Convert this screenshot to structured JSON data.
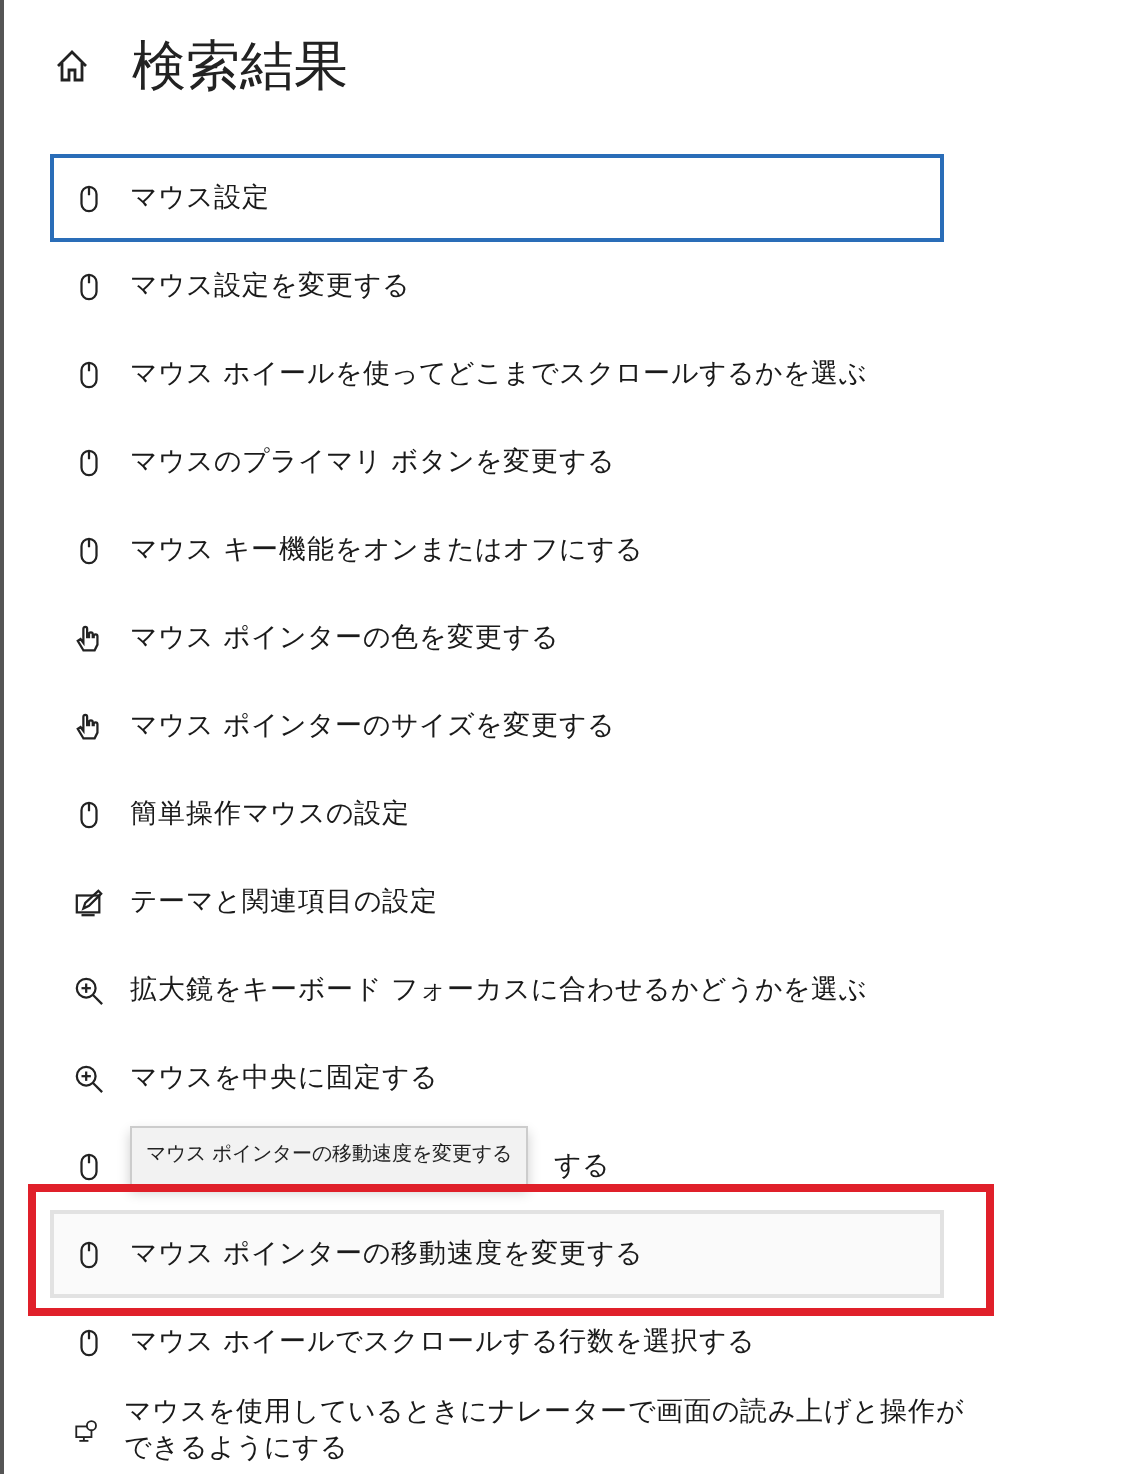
{
  "header": {
    "title": "検索結果"
  },
  "results": [
    {
      "kind": "mouse",
      "label": "マウス設定",
      "focused": true,
      "hovered": false
    },
    {
      "kind": "mouse",
      "label": "マウス設定を変更する",
      "focused": false,
      "hovered": false
    },
    {
      "kind": "mouse",
      "label": "マウス ホイールを使ってどこまでスクロールするかを選ぶ",
      "focused": false,
      "hovered": false
    },
    {
      "kind": "mouse",
      "label": "マウスのプライマリ ボタンを変更する",
      "focused": false,
      "hovered": false
    },
    {
      "kind": "mouse",
      "label": "マウス キー機能をオンまたはオフにする",
      "focused": false,
      "hovered": false
    },
    {
      "kind": "pointer",
      "label": "マウス ポインターの色を変更する",
      "focused": false,
      "hovered": false
    },
    {
      "kind": "pointer",
      "label": "マウス ポインターのサイズを変更する",
      "focused": false,
      "hovered": false
    },
    {
      "kind": "mouse",
      "label": "簡単操作マウスの設定",
      "focused": false,
      "hovered": false
    },
    {
      "kind": "theme",
      "label": "テーマと関連項目の設定",
      "focused": false,
      "hovered": false
    },
    {
      "kind": "magnifier",
      "label": "拡大鏡をキーボード フォーカスに合わせるかどうかを選ぶ",
      "focused": false,
      "hovered": false
    },
    {
      "kind": "magnifier",
      "label": "マウスを中央に固定する",
      "focused": false,
      "hovered": false
    },
    {
      "kind": "mouse",
      "label": "する",
      "focused": false,
      "hovered": false,
      "partly_hidden": true
    },
    {
      "kind": "mouse",
      "label": "マウス ポインターの移動速度を変更する",
      "focused": false,
      "hovered": true
    },
    {
      "kind": "mouse",
      "label": "マウス ホイールでスクロールする行数を選択する",
      "focused": false,
      "hovered": false
    },
    {
      "kind": "narrator",
      "label": "マウスを使用しているときにナレーターで画面の読み上げと操作ができるようにする",
      "focused": false,
      "hovered": false
    }
  ],
  "tooltip": {
    "text": "マウス ポインターの移動速度を変更する"
  }
}
